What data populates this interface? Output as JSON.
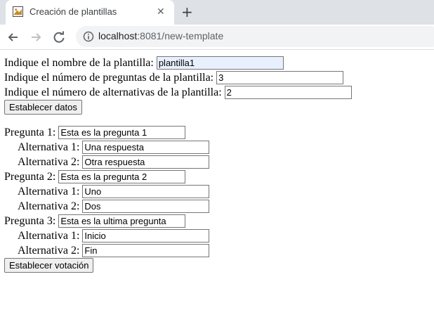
{
  "browser": {
    "tab_title": "Creación de plantillas",
    "close_glyph": "✕",
    "new_tab_glyph": "+",
    "url_host": "localhost",
    "url_rest": ":8081/new-template"
  },
  "form": {
    "name_label": "Indique el nombre de la plantilla:",
    "name_value": "plantilla1",
    "questions_label": "Indique el número de preguntas de la plantilla:",
    "questions_value": "3",
    "alternatives_label": "Indique el número de alternativas de la plantilla:",
    "alternatives_value": "2",
    "set_data_button": "Establecer datos"
  },
  "questions": [
    {
      "label": "Pregunta 1:",
      "value": "Esta es la pregunta 1",
      "alternatives": [
        {
          "label": "Alternativa 1:",
          "value": "Una respuesta"
        },
        {
          "label": "Alternativa 2:",
          "value": "Otra respuesta"
        }
      ]
    },
    {
      "label": "Pregunta 2:",
      "value": "Esta es la pregunta 2",
      "alternatives": [
        {
          "label": "Alternativa 1:",
          "value": "Uno"
        },
        {
          "label": "Alternativa 2:",
          "value": "Dos"
        }
      ]
    },
    {
      "label": "Pregunta 3:",
      "value": "Esta es la ultima pregunta",
      "alternatives": [
        {
          "label": "Alternativa 1:",
          "value": "Inicio"
        },
        {
          "label": "Alternativa 2:",
          "value": "Fin"
        }
      ]
    }
  ],
  "submit_button": "Establecer votación"
}
